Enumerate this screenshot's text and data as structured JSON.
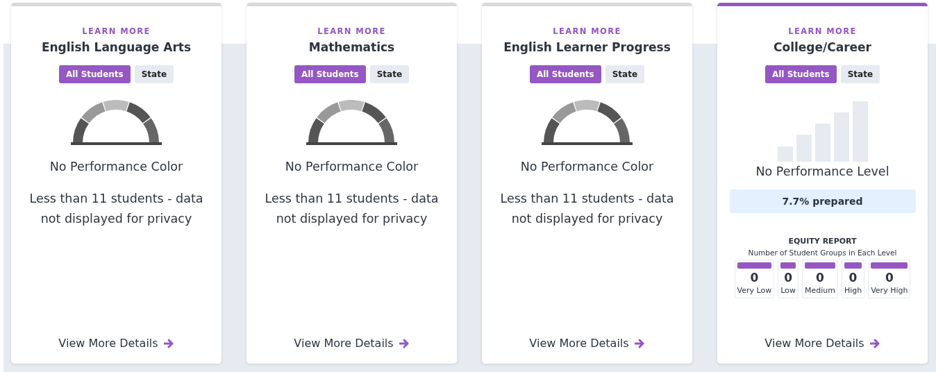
{
  "cards": [
    {
      "kind": "gauge",
      "selected": false,
      "link": "LEARN MORE",
      "title": "English Language Arts",
      "toggles": [
        {
          "label": "All Students",
          "selected": true
        },
        {
          "label": "State",
          "selected": false
        }
      ],
      "status": "No Performance Color",
      "note": "Less than 11 students - data not displayed for privacy",
      "details": "View More Details"
    },
    {
      "kind": "gauge",
      "selected": false,
      "link": "LEARN MORE",
      "title": "Mathematics",
      "toggles": [
        {
          "label": "All Students",
          "selected": true
        },
        {
          "label": "State",
          "selected": false
        }
      ],
      "status": "No Performance Color",
      "note": "Less than 11 students - data not displayed for privacy",
      "details": "View More Details"
    },
    {
      "kind": "gauge",
      "selected": false,
      "link": "LEARN MORE",
      "title": "English Learner Progress",
      "toggles": [
        {
          "label": "All Students",
          "selected": true
        },
        {
          "label": "State",
          "selected": false
        }
      ],
      "status": "No Performance Color",
      "note": "Less than 11 students - data not displayed for privacy",
      "details": "View More Details"
    },
    {
      "kind": "bars",
      "selected": true,
      "link": "LEARN MORE",
      "title": "College/Career",
      "toggles": [
        {
          "label": "All Students",
          "selected": true
        },
        {
          "label": "State",
          "selected": false
        }
      ],
      "status": "No Performance Level",
      "prepared": "7.7% prepared",
      "equity": {
        "title": "EQUITY REPORT",
        "subtitle": "Number of Student Groups in Each Level",
        "levels": [
          {
            "count": "0",
            "label": "Very Low"
          },
          {
            "count": "0",
            "label": "Low"
          },
          {
            "count": "0",
            "label": "Medium"
          },
          {
            "count": "0",
            "label": "High"
          },
          {
            "count": "0",
            "label": "Very High"
          }
        ]
      },
      "details": "View More Details"
    }
  ]
}
